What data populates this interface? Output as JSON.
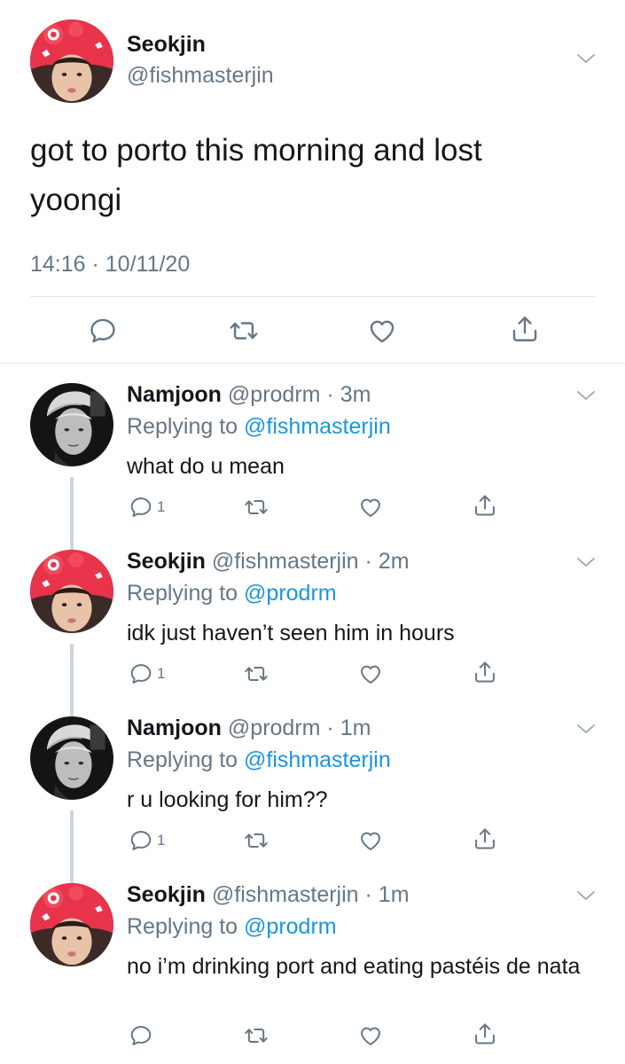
{
  "main_tweet": {
    "name": "Seokjin",
    "handle": "@fishmasterjin",
    "text": "got to porto this morning and lost yoongi",
    "timestamp": "14:16 · 10/11/20"
  },
  "replies": [
    {
      "name": "Namjoon",
      "handle": "@prodrm",
      "time": "3m",
      "replying_prefix": "Replying to",
      "replying_to": "@fishmasterjin",
      "text": "what do u mean",
      "reply_count": "1",
      "avatar": "namjoon-avatar"
    },
    {
      "name": "Seokjin",
      "handle": "@fishmasterjin",
      "time": "2m",
      "replying_prefix": "Replying to",
      "replying_to": "@prodrm",
      "text": "idk just haven’t seen him in hours",
      "reply_count": "1",
      "avatar": "seokjin-avatar"
    },
    {
      "name": "Namjoon",
      "handle": "@prodrm",
      "time": "1m",
      "replying_prefix": "Replying to",
      "replying_to": "@fishmasterjin",
      "text": "r u looking for him??",
      "reply_count": "1",
      "avatar": "namjoon-avatar"
    },
    {
      "name": "Seokjin",
      "handle": "@fishmasterjin",
      "time": "1m",
      "replying_prefix": "Replying to",
      "replying_to": "@prodrm",
      "text": "no i’m drinking port and eating pastéis de nata",
      "reply_count": "",
      "avatar": "seokjin-avatar"
    }
  ],
  "icons": {
    "reply": "reply-icon",
    "retweet": "retweet-icon",
    "like": "heart-icon",
    "share": "share-icon",
    "more": "chevron-down-icon"
  },
  "colors": {
    "text": "#14171a",
    "secondary": "#657786",
    "link": "#1b95e0",
    "divider": "#e1e8ed",
    "thread_line": "#ccd6dd"
  }
}
